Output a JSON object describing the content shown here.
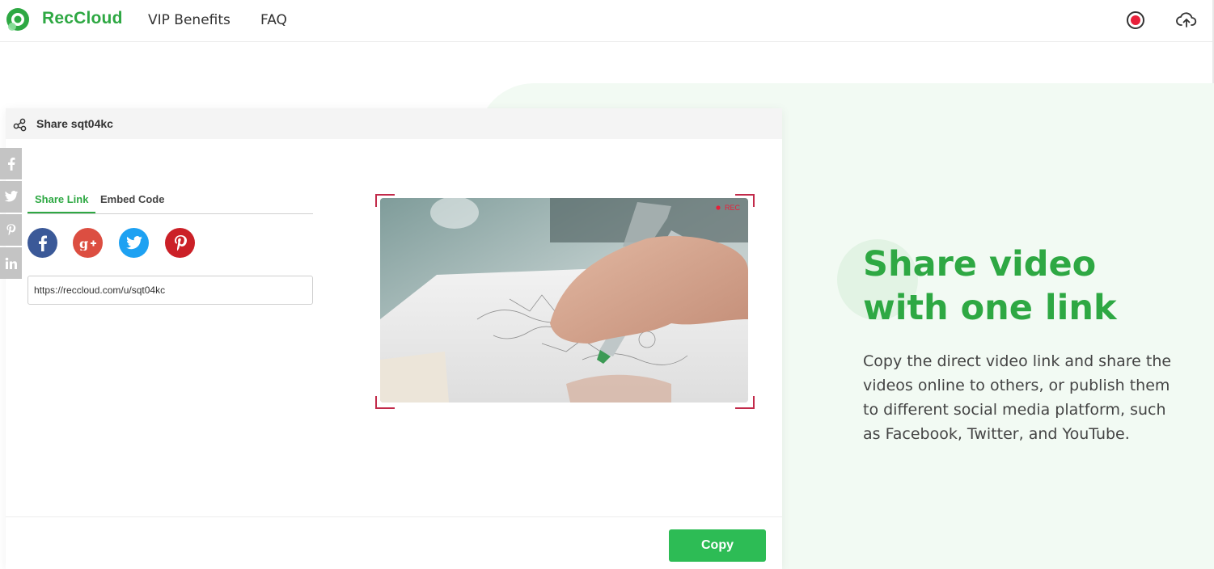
{
  "header": {
    "brand": "RecCloud",
    "nav": [
      "VIP Benefits",
      "FAQ"
    ],
    "icons": [
      "record-icon",
      "cloud-upload-icon"
    ]
  },
  "share_panel": {
    "title": "Share sqt04kc",
    "tabs": [
      {
        "label": "Share Link",
        "active": true
      },
      {
        "label": "Embed Code",
        "active": false
      }
    ],
    "social_icons": [
      "facebook-icon",
      "google-plus-icon",
      "twitter-icon",
      "pinterest-icon"
    ],
    "link": {
      "value": "https://reccloud.com/u/sqt04kc"
    },
    "video": {
      "badge": "REC"
    },
    "copy_label": "Copy"
  },
  "side_share": [
    "facebook-icon",
    "twitter-icon",
    "pinterest-icon",
    "linkedin-icon"
  ],
  "hero": {
    "title": "Share video with one link",
    "description": "Copy the direct video link and share the videos online to others, or publish them to different social media platform, such as Facebook, Twitter, and YouTube."
  },
  "colors": {
    "brand_green": "#2ea843",
    "copy_button": "#2dbc55",
    "hero_background": "#f2faf3",
    "rec_red": "#e8203a"
  }
}
